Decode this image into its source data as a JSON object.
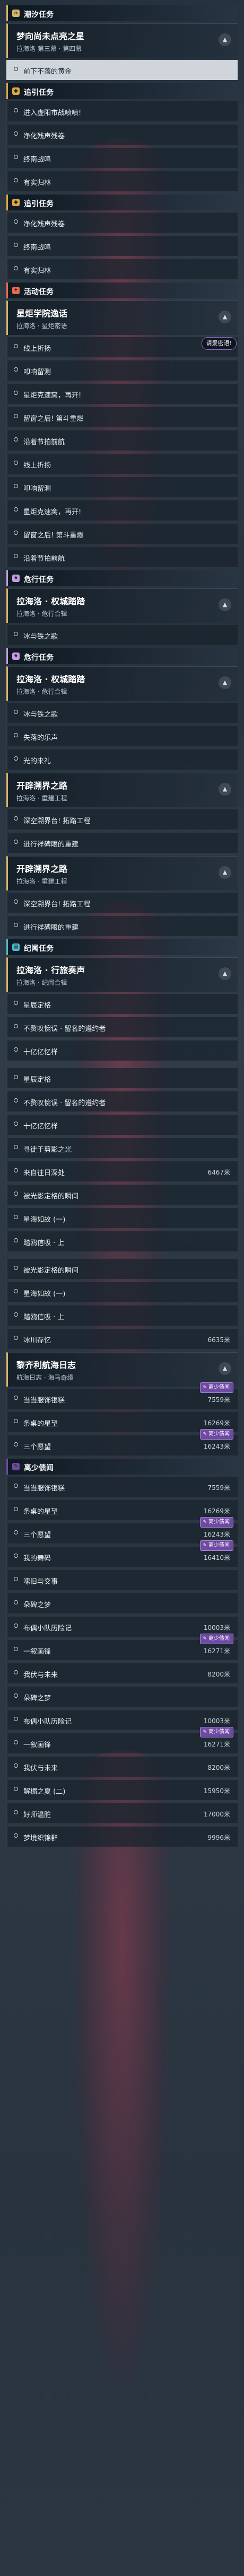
{
  "colors": {
    "chaoxi": "#d6b56b",
    "zhuiyin": "#e0a640",
    "huodong": "#e96b4a",
    "weixing": "#c69bdf",
    "jiyi": "#4fb8c9",
    "badge": "#6f4aa3"
  },
  "rows": [
    {
      "kind": "section",
      "label": "潮汐任务",
      "icon": "tide-icon",
      "color": "#d6b56b"
    },
    {
      "kind": "card",
      "title": "梦向尚未点亮之星",
      "sub": "拉海洛 第三幕 · 第四幕"
    },
    {
      "kind": "entry",
      "label": "前下不落的黄金",
      "active": true
    },
    {
      "kind": "section",
      "label": "追引任务",
      "icon": "trace-icon",
      "color": "#e0a640"
    },
    {
      "kind": "entry",
      "label": "进入虚阳市战喷喷!"
    },
    {
      "kind": "entry",
      "label": "净化残声残卷"
    },
    {
      "kind": "entry",
      "label": "终南战鸣"
    },
    {
      "kind": "entry",
      "label": "有实归林"
    },
    {
      "kind": "section",
      "label": "追引任务",
      "icon": "trace-icon",
      "color": "#e0a640"
    },
    {
      "kind": "entry",
      "label": "净化残声残卷"
    },
    {
      "kind": "entry",
      "label": "终南战鸣"
    },
    {
      "kind": "entry",
      "label": "有实归林"
    },
    {
      "kind": "section",
      "label": "活动任务",
      "icon": "event-icon",
      "color": "#e96b4a"
    },
    {
      "kind": "card",
      "title": "星炬学院逸话",
      "sub": "拉海洛 · 星炬密语"
    },
    {
      "kind": "entry",
      "label": "线上折扬",
      "flag": "请爱密语!"
    },
    {
      "kind": "entry",
      "label": "叩响留测"
    },
    {
      "kind": "entry",
      "label": "星炬克速窝，再开!"
    },
    {
      "kind": "entry",
      "label": "留窗之后! 第斗重燃"
    },
    {
      "kind": "entry",
      "label": "沿着节拍前航"
    },
    {
      "kind": "entry",
      "label": "线上折扬"
    },
    {
      "kind": "entry",
      "label": "叩响留测"
    },
    {
      "kind": "entry",
      "label": "星炬克速窝，再开!"
    },
    {
      "kind": "entry",
      "label": "留窗之后! 第斗重燃"
    },
    {
      "kind": "entry",
      "label": "沿着节拍前航"
    },
    {
      "kind": "section",
      "label": "危行任务",
      "icon": "star-icon",
      "color": "#c69bdf"
    },
    {
      "kind": "card",
      "title": "拉海洛 · 权城踏踏",
      "sub": "拉海洛 · 危行合辑"
    },
    {
      "kind": "entry",
      "label": "冰与铁之歌"
    },
    {
      "kind": "section",
      "label": "危行任务",
      "icon": "star-icon",
      "color": "#c69bdf"
    },
    {
      "kind": "card",
      "title": "拉海洛 · 权城踏踏",
      "sub": "拉海洛 · 危行合辑"
    },
    {
      "kind": "entry",
      "label": "冰与铁之歌"
    },
    {
      "kind": "entry",
      "label": "失落的乐声"
    },
    {
      "kind": "entry",
      "label": "光的来礼"
    },
    {
      "kind": "card",
      "title": "开辟溯界之路",
      "sub": "拉海洛 · 重建工程"
    },
    {
      "kind": "entry",
      "label": "深空溯界台! 拓路工程"
    },
    {
      "kind": "entry",
      "label": "进行祥碑眼的重建"
    },
    {
      "kind": "card",
      "title": "开辟溯界之路",
      "sub": "拉海洛 · 重建工程"
    },
    {
      "kind": "entry",
      "label": "深空溯界台! 拓路工程"
    },
    {
      "kind": "entry",
      "label": "进行祥碑眼的重建"
    },
    {
      "kind": "section",
      "label": "纪闻任务",
      "icon": "book-icon",
      "color": "#4fb8c9"
    },
    {
      "kind": "card",
      "title": "拉海洛 · 行旅奏声",
      "sub": "拉海洛 · 纪闻合辑"
    },
    {
      "kind": "entry",
      "label": "星辰定格"
    },
    {
      "kind": "entry",
      "label": "不赘叹惋误 · 留名的遵约者"
    },
    {
      "kind": "entry",
      "label": "十亿亿忆样"
    },
    {
      "kind": "spacer"
    },
    {
      "kind": "entry",
      "label": "星辰定格"
    },
    {
      "kind": "entry",
      "label": "不赘叹惋误 · 留名的遵约者"
    },
    {
      "kind": "entry",
      "label": "十亿亿忆样"
    },
    {
      "kind": "entry",
      "label": "寻徒于剪影之光"
    },
    {
      "kind": "entry",
      "label": "来自往日深处",
      "dist": "6467米"
    },
    {
      "kind": "entry",
      "label": "被光影定格的瞬间"
    },
    {
      "kind": "entry",
      "label": "星海如故 (一)"
    },
    {
      "kind": "entry",
      "label": "踏鸥信吸 · 上"
    },
    {
      "kind": "spacer"
    },
    {
      "kind": "entry",
      "label": "被光影定格的瞬间"
    },
    {
      "kind": "entry",
      "label": "星海如故 (一)"
    },
    {
      "kind": "entry",
      "label": "踏鸥信吸 · 上"
    },
    {
      "kind": "entry",
      "label": "冰川存忆",
      "dist": "6635米"
    },
    {
      "kind": "card",
      "title": "黎齐利航海日志",
      "sub": "航海日志 · 海马奇缘"
    },
    {
      "kind": "entry",
      "label": "当当服饰银糕",
      "dist": "7559米",
      "badge": "离少债闻"
    },
    {
      "kind": "entry",
      "label": "条桌的星望",
      "dist": "16269米"
    },
    {
      "kind": "entry",
      "label": "三个愿望",
      "dist": "16243米",
      "badge": "离少债闻"
    },
    {
      "kind": "section",
      "label": "离少债闻",
      "icon": "log-icon",
      "color": "#6f4aa3"
    },
    {
      "kind": "entry",
      "label": "当当服饰银糕",
      "dist": "7559米"
    },
    {
      "kind": "entry",
      "label": "条桌的星望",
      "dist": "16269米"
    },
    {
      "kind": "entry",
      "label": "三个愿望",
      "dist": "16243米",
      "badge": "离少债闻"
    },
    {
      "kind": "entry",
      "label": "我的舞码",
      "dist": "16410米",
      "badge": "离少债闻"
    },
    {
      "kind": "entry",
      "label": "嗦旧与交事"
    },
    {
      "kind": "entry",
      "label": "朵碑之梦"
    },
    {
      "kind": "entry",
      "label": "布偶小队历险记",
      "dist": "10003米"
    },
    {
      "kind": "entry",
      "label": "一叙画锋",
      "dist": "16271米",
      "badge": "离少债闻"
    },
    {
      "kind": "entry",
      "label": "我伏与未来",
      "dist": "8200米"
    },
    {
      "kind": "entry",
      "label": "朵碑之梦"
    },
    {
      "kind": "entry",
      "label": "布偶小队历险记",
      "dist": "10003米"
    },
    {
      "kind": "entry",
      "label": "一叙画锋",
      "dist": "16271米",
      "badge": "离少债闻"
    },
    {
      "kind": "entry",
      "label": "我伏与未来",
      "dist": "8200米"
    },
    {
      "kind": "entry",
      "label": "解楣之夏 (二)",
      "dist": "15950米"
    },
    {
      "kind": "entry",
      "label": "好师温脏",
      "dist": "17000米"
    },
    {
      "kind": "entry",
      "label": "梦境织锦群",
      "dist": "9996米"
    }
  ]
}
